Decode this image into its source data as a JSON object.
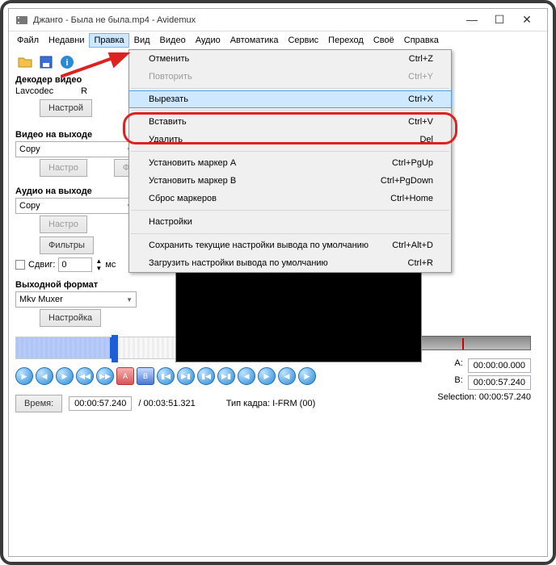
{
  "window": {
    "title": "Джанго - Была не была.mp4 - Avidemux"
  },
  "menubar": [
    "Файл",
    "Недавни",
    "Правка",
    "Вид",
    "Видео",
    "Аудио",
    "Автоматика",
    "Сервис",
    "Переход",
    "Своё",
    "Справка"
  ],
  "dropdown": {
    "open_index": 2,
    "items": [
      {
        "label": "Отменить",
        "shortcut": "Ctrl+Z",
        "enabled": true
      },
      {
        "label": "Повторить",
        "shortcut": "Ctrl+Y",
        "enabled": false
      },
      {
        "sep": true
      },
      {
        "label": "Вырезать",
        "shortcut": "Ctrl+X",
        "enabled": true,
        "highlight": true
      },
      {
        "sep": true
      },
      {
        "label": "Вставить",
        "shortcut": "Ctrl+V",
        "enabled": true
      },
      {
        "label": "Удалить",
        "shortcut": "Del",
        "enabled": true
      },
      {
        "sep": true
      },
      {
        "label": "Установить маркер A",
        "shortcut": "Ctrl+PgUp",
        "enabled": true
      },
      {
        "label": "Установить маркер B",
        "shortcut": "Ctrl+PgDown",
        "enabled": true
      },
      {
        "label": "Сброс маркеров",
        "shortcut": "Ctrl+Home",
        "enabled": true
      },
      {
        "sep": true
      },
      {
        "label": "Настройки",
        "shortcut": "",
        "enabled": true
      },
      {
        "sep": true
      },
      {
        "label": "Сохранить текущие настройки вывода по умолчанию",
        "shortcut": "Ctrl+Alt+D",
        "enabled": true
      },
      {
        "label": "Загрузить настройки вывода по умолчанию",
        "shortcut": "Ctrl+R",
        "enabled": true
      }
    ]
  },
  "left": {
    "decoder_label": "Декодер видео",
    "decoder_value": "Lavcodec",
    "decoder_r": "R",
    "config": "Настрой",
    "video_out_label": "Видео на выходе",
    "video_codec": "Copy",
    "configure": "Настро",
    "filters": "Фильтр",
    "audio_out_label": "Аудио на выходе",
    "audio_codec": "Copy",
    "shift_label": "Сдвиг:",
    "shift_value": "0",
    "shift_unit": "мс",
    "format_label": "Выходной формат",
    "format_value": "Mkv Muxer",
    "format_btn": "Настройка",
    "filters_full": "Фильтры"
  },
  "status": {
    "time_label": "Время:",
    "time_value": "00:00:57.240",
    "duration": "/ 00:03:51.321",
    "frametype": "Тип кадра:  I-FRM (00)",
    "a_label": "A:",
    "a_value": "00:00:00.000",
    "b_label": "B:",
    "b_value": "00:00:57.240",
    "sel_label": "Selection: 00:00:57.240"
  }
}
